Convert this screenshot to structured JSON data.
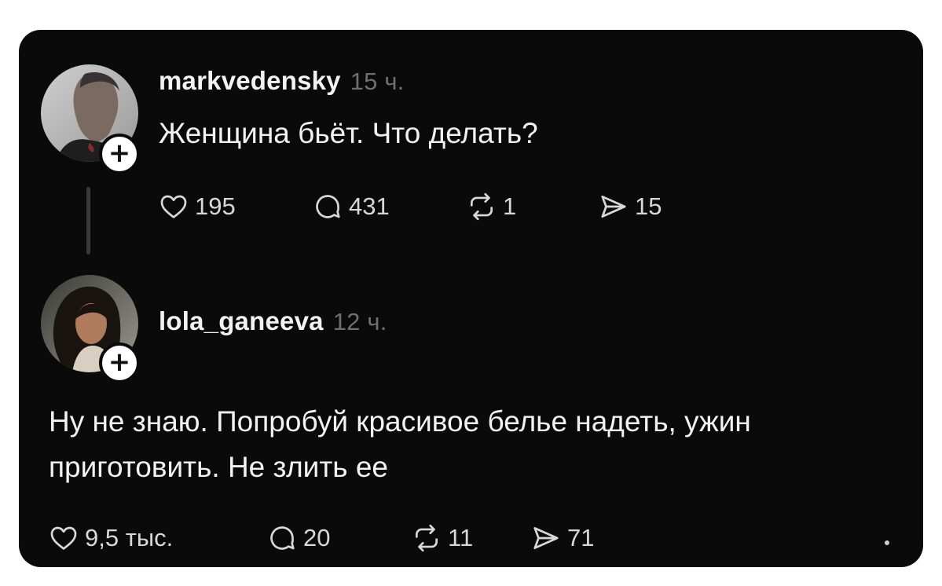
{
  "posts": [
    {
      "username": "markvedensky",
      "time": "15 ч.",
      "text": "Женщина бьёт. Что делать?",
      "likes": "195",
      "comments": "431",
      "reposts": "1",
      "shares": "15"
    },
    {
      "username": "lola_ganeeva",
      "time": "12 ч.",
      "text_line1": "Ну не знаю. Попробуй красивое белье надеть, ужин",
      "text_line2": "приготовить. Не злить ее",
      "likes": "9,5 тыс.",
      "comments": "20",
      "reposts": "11",
      "shares": "71"
    }
  ],
  "icons": {
    "follow": "+",
    "like": "heart-icon",
    "comment": "comment-bubble-icon",
    "repost": "repost-icon",
    "share": "send-icon"
  }
}
